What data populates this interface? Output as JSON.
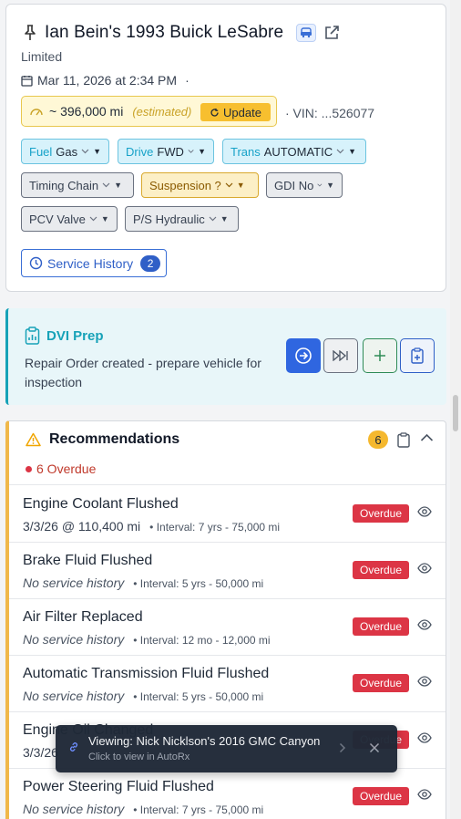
{
  "vehicle": {
    "title": "Ian Bein's 1993 Buick LeSabre",
    "trim": "Limited",
    "date": "Mar 11, 2026 at 2:34 PM",
    "date_sep": "·",
    "mileage": "~ 396,000 mi",
    "mileage_note": "(estimated)",
    "update_label": "Update",
    "vin": "·  VIN: ...526077"
  },
  "tags": [
    {
      "label": "Fuel",
      "value": "Gas"
    },
    {
      "label": "Drive",
      "value": "FWD"
    },
    {
      "label": "Trans",
      "value": "AUTOMATIC"
    },
    {
      "label": "",
      "value": "Timing Chain"
    },
    {
      "label": "",
      "value": "Suspension ?"
    },
    {
      "label": "",
      "value": "GDI No"
    },
    {
      "label": "",
      "value": "PCV Valve"
    },
    {
      "label": "",
      "value": "P/S Hydraulic"
    }
  ],
  "service_history": {
    "label": "Service History",
    "count": "2"
  },
  "dvi": {
    "title": "DVI Prep",
    "description": "Repair Order created - prepare vehicle for inspection"
  },
  "recommendations": {
    "title": "Recommendations",
    "count": "6",
    "overdue_summary": "6 Overdue",
    "items": [
      {
        "name": "Engine Coolant Flushed",
        "history": "3/3/26 @ 110,400 mi",
        "interval": "• Interval: 7 yrs - 75,000 mi",
        "status": "Overdue"
      },
      {
        "name": "Brake Fluid Flushed",
        "history": "No service history",
        "interval": "• Interval: 5 yrs - 50,000 mi",
        "status": "Overdue"
      },
      {
        "name": "Air Filter Replaced",
        "history": "No service history",
        "interval": "• Interval: 12 mo - 12,000 mi",
        "status": "Overdue"
      },
      {
        "name": "Automatic Transmission Fluid Flushed",
        "history": "No service history",
        "interval": "• Interval: 5 yrs - 50,000 mi",
        "status": "Overdue"
      },
      {
        "name": "Engine Oil Changed",
        "history": "3/3/26",
        "interval": "",
        "status": "Overdue"
      },
      {
        "name": "Power Steering Fluid Flushed",
        "history": "No service history",
        "interval": "• Interval: 7 yrs - 75,000 mi",
        "status": "Overdue"
      }
    ]
  },
  "toast": {
    "title": "Viewing: Nick Nicklson's 2016 GMC Canyon",
    "subtitle": "Click to view in AutoRx"
  },
  "colors": {
    "accent_blue": "#2f5fc7",
    "teal": "#17a2b8",
    "overdue_red": "#dc3545",
    "warning_yellow": "#f5b82e",
    "add_green": "#2e8b57"
  },
  "icons": [
    "pin-icon",
    "car-icon",
    "external-link-icon",
    "calendar-icon",
    "gauge-icon",
    "refresh-icon",
    "chevron-down-icon",
    "clock-icon",
    "clipboard-chart-icon",
    "arrow-right-circle-icon",
    "skip-forward-icon",
    "plus-icon",
    "clipboard-plus-icon",
    "warning-icon",
    "clipboard-icon",
    "chevron-up-icon",
    "eye-icon",
    "link-icon",
    "close-icon"
  ]
}
